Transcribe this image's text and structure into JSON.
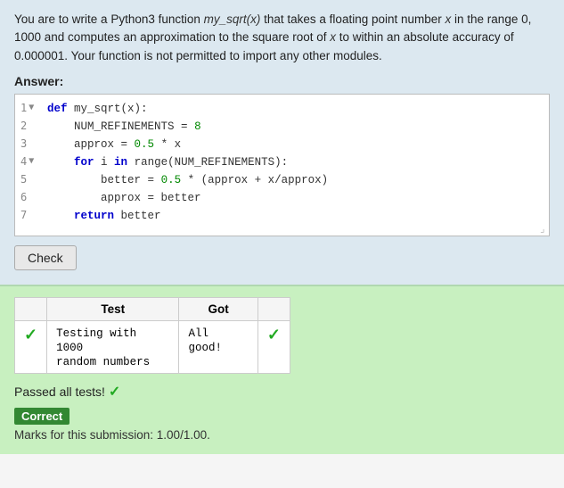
{
  "instructions": {
    "text": "You are to write a Python3 function ",
    "function_name": "my_sqrt(x)",
    "text2": " that takes a floating point number ",
    "var_x": "x",
    "text3": " in the range 0, 1000 and computes an approximation to the square root of ",
    "var_x2": "x",
    "text4": " to within an absolute accuracy of 0.000001. Your function is not permitted to import any other modules."
  },
  "answer_label": "Answer:",
  "code_lines": [
    {
      "line": "1",
      "arrow": "▼",
      "code": "def my_sqrt(x):"
    },
    {
      "line": "2",
      "arrow": "",
      "code": "    NUM_REFINEMENTS = 8"
    },
    {
      "line": "3",
      "arrow": "",
      "code": "    approx = 0.5 * x"
    },
    {
      "line": "4",
      "arrow": "▼",
      "code": "    for i in range(NUM_REFINEMENTS):"
    },
    {
      "line": "5",
      "arrow": "",
      "code": "        better = 0.5 * (approx + x/approx)"
    },
    {
      "line": "6",
      "arrow": "",
      "code": "        approx = better"
    },
    {
      "line": "7",
      "arrow": "",
      "code": "    return better"
    }
  ],
  "check_button": "Check",
  "results": {
    "table_header_test": "Test",
    "table_header_got": "Got",
    "rows": [
      {
        "status_icon": "✓",
        "test_text": "Testing with 1000\nrandom numbers",
        "got_text": "All good!",
        "got_icon": "✓"
      }
    ],
    "passed_message": "Passed all tests!",
    "correct_badge": "Correct",
    "marks_text": "Marks for this submission: 1.00/1.00."
  }
}
